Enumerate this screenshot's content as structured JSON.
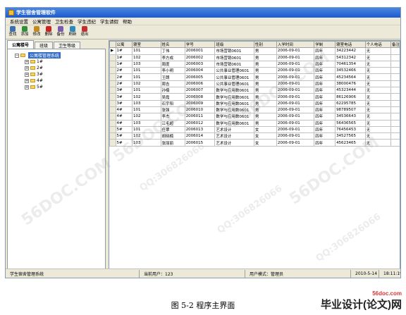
{
  "window": {
    "title": "学生宿舍管理软件"
  },
  "menu": [
    "系统设置",
    "公寓管理",
    "卫生检查",
    "学生违纪",
    "学生请假",
    "帮助"
  ],
  "toolbar": [
    {
      "label": "查找",
      "icon": "binoculars-icon",
      "color": "#3a6fb0"
    },
    {
      "label": "添加",
      "icon": "add-icon",
      "color": "#2f8f3a"
    },
    {
      "label": "修改",
      "icon": "edit-icon",
      "color": "#c28a20"
    },
    {
      "label": "删除",
      "icon": "delete-icon",
      "color": "#cc2222"
    },
    {
      "label": "备份",
      "icon": "backup-icon",
      "color": "#7a5ab0"
    },
    {
      "label": "刷新",
      "icon": "refresh-icon",
      "color": "#2a8ac0"
    },
    {
      "label": "退出",
      "icon": "exit-icon",
      "color": "#c03030"
    }
  ],
  "left_tabs": [
    "公寓楼号",
    "班级",
    "卫生等级"
  ],
  "tree": {
    "root": "公寓楼管理系统",
    "nodes": [
      "1#",
      "2#",
      "3#",
      "4#",
      "5#"
    ]
  },
  "grid": {
    "columns": [
      "公寓",
      "寝室",
      "姓名",
      "学号",
      "班级",
      "性别",
      "入学时间",
      "学制",
      "寝室电话",
      "个人电话",
      "备注"
    ],
    "rows": [
      [
        "1#",
        "101",
        "丁伟",
        "2006001",
        "市场营销0601",
        "男",
        "2006-09-01",
        "四年",
        "34223442",
        "无",
        ""
      ],
      [
        "1#",
        "102",
        "李方成",
        "2006002",
        "市场营销0601",
        "男",
        "2006-09-01",
        "四年",
        "54312342",
        "无",
        ""
      ],
      [
        "1#",
        "103",
        "周度",
        "2006003",
        "市场营销0601",
        "男",
        "2006-09-01",
        "四年",
        "70461354",
        "无",
        ""
      ],
      [
        "2#",
        "101",
        "李小明",
        "2006004",
        "公共事业管理0601",
        "男",
        "2006-09-01",
        "四年",
        "34532466",
        "无",
        ""
      ],
      [
        "2#",
        "101",
        "王朗",
        "2006005",
        "公共事业管理0601",
        "男",
        "2006-09-01",
        "四年",
        "45234564",
        "无",
        ""
      ],
      [
        "2#",
        "102",
        "周吉",
        "2006006",
        "公共事业管理0601",
        "男",
        "2006-09-01",
        "四年",
        "38000476",
        "无",
        ""
      ],
      [
        "3#",
        "101",
        "孙楠",
        "2006007",
        "数学与应用数0601",
        "男",
        "2006-09-01",
        "四年",
        "45323444",
        "无",
        ""
      ],
      [
        "3#",
        "102",
        "吴霞",
        "2006008",
        "数学与应用数0601",
        "男",
        "2006-09-01",
        "四年",
        "86126906",
        "无",
        ""
      ],
      [
        "3#",
        "103",
        "石宇阳",
        "2006009",
        "数学与应用数0601",
        "男",
        "2006-09-01",
        "四年",
        "62295785",
        "无",
        ""
      ],
      [
        "4#",
        "101",
        "张强",
        "2006010",
        "数学与应用数0601",
        "男",
        "2006-09-01",
        "四年",
        "98789507",
        "无",
        ""
      ],
      [
        "4#",
        "102",
        "李杰",
        "2006011",
        "数学与应用数0601",
        "男",
        "2006-09-01",
        "四年",
        "34536643",
        "无",
        ""
      ],
      [
        "4#",
        "103",
        "江毛超",
        "2006012",
        "数学与应用数0601",
        "男",
        "2006-09-01",
        "四年",
        "56436565",
        "无",
        ""
      ],
      [
        "5#",
        "101",
        "任翠",
        "2006013",
        "艺术设计",
        "女",
        "2006-09-01",
        "四年",
        "76456453",
        "无",
        ""
      ],
      [
        "5#",
        "102",
        "胡晓楠",
        "2006014",
        "艺术设计",
        "女",
        "2006-09-01",
        "四年",
        "34527565",
        "无",
        ""
      ],
      [
        "5#",
        "103",
        "张丽丽",
        "2006015",
        "艺术设计",
        "女",
        "2006-09-01",
        "四年",
        "45623465",
        "无",
        ""
      ]
    ]
  },
  "status": {
    "app_name": "学生宿舍管理系统",
    "current_user": "当前用户：123",
    "user_mode": "用户模式：管理员",
    "date": "2010-5-14",
    "time": "18:11:19"
  },
  "watermarks": [
    "56DOC.COM",
    "QQ:306826066"
  ],
  "caption": "图 5-2 程序主界面",
  "site_logo": {
    "domain": "56doc.com",
    "brand": "毕业设计(论文)网"
  }
}
